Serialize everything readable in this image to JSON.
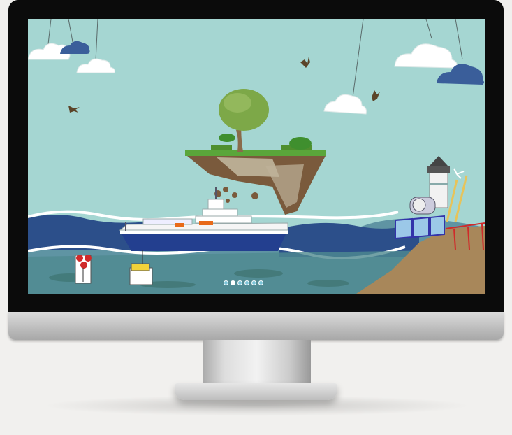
{
  "colors": {
    "sky": "#a5d6d2",
    "ocean_dark": "#2c4f8a",
    "ocean_teal": "#5f94a3",
    "island_grass": "#5aa63a",
    "ship_hull": "#233f8f",
    "sand": "#a8875a",
    "bezel": "#0b0b0b",
    "cloud_blue": "#3a5e9a"
  },
  "icons": {
    "next": "chevron-right-icon"
  },
  "carousel": {
    "slide_count": 6,
    "active_index": 1
  }
}
